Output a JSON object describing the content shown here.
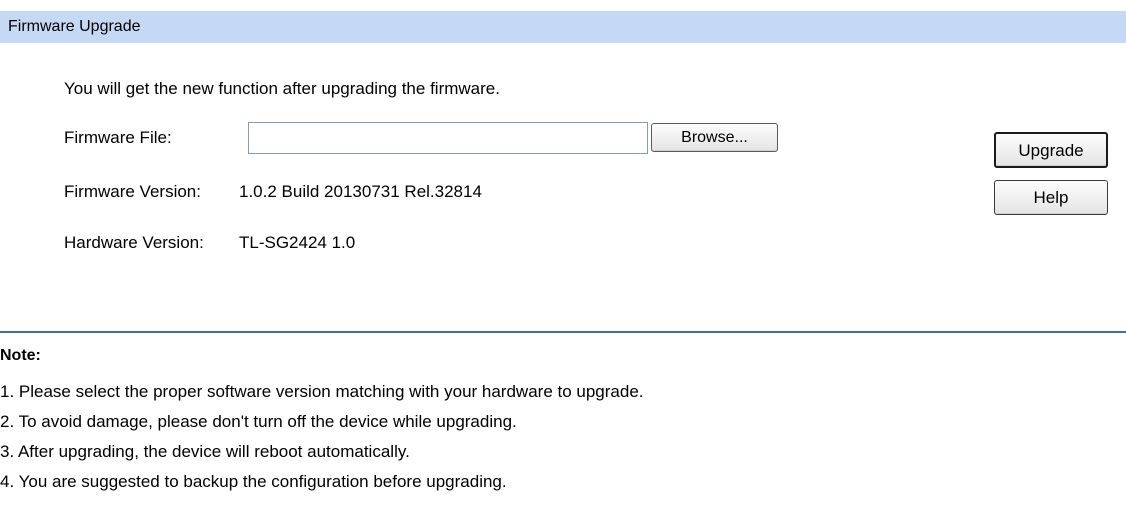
{
  "header": {
    "title": "Firmware Upgrade"
  },
  "intro": "You will get the new function after upgrading the firmware.",
  "firmware_file": {
    "label": "Firmware File:",
    "value": "",
    "browse_label": "Browse..."
  },
  "firmware_version": {
    "label": "Firmware Version:",
    "value": "1.0.2 Build 20130731 Rel.32814"
  },
  "hardware_version": {
    "label": "Hardware Version:",
    "value": "TL-SG2424 1.0"
  },
  "buttons": {
    "upgrade": "Upgrade",
    "help": "Help"
  },
  "note": {
    "title": "Note:",
    "items": [
      "1. Please select the proper software version matching with your hardware to upgrade.",
      "2. To avoid damage, please don't turn off the device while upgrading.",
      "3. After upgrading, the device will reboot automatically.",
      "4. You are suggested to backup the configuration before upgrading."
    ]
  },
  "colors": {
    "header_bg": "#c5d9f5",
    "divider": "#3f6f9b"
  }
}
